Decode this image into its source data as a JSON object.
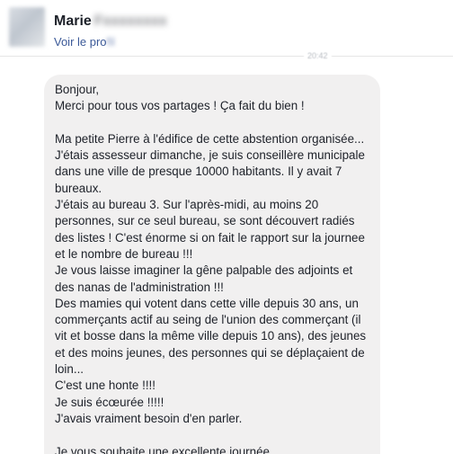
{
  "sender": {
    "first_name": "Marie",
    "last_name": "Fxxxxxxxx",
    "profile_link_visible": "Voir le pro",
    "profile_link_blurred": "fil"
  },
  "divider_timestamp": "20:42",
  "message": {
    "lines": [
      "Bonjour,",
      "Merci pour tous vos partages ! Ça fait du bien !",
      "",
      "Ma petite Pierre à l'édifice de cette abstention organisée...",
      "J'étais assesseur dimanche, je suis conseillère municipale",
      "dans une ville de presque 10000 habitants. Il y avait 7",
      "bureaux.",
      "J'étais au bureau 3. Sur l'après-midi, au moins 20",
      "personnes, sur ce seul bureau, se sont découvert radiés",
      "des listes ! C'est énorme si on fait le rapport sur la journee",
      "et le nombre de bureau !!!",
      "Je vous laisse imaginer la gêne palpable des adjoints et",
      "des nanas de l'administration !!!",
      "Des mamies qui votent dans cette ville depuis 30 ans, un",
      "commerçants actif au seing de l'union des commerçant (il",
      "vit et bosse dans la même ville depuis 10 ans), des jeunes",
      "et des moins jeunes, des personnes qui se déplaçaient de",
      "loin...",
      "C'est une honte !!!!",
      "Je suis écœurée !!!!!",
      "J'avais vraiment besoin d'en parler.",
      "",
      "Je vous souhaite une excellente journée."
    ]
  }
}
